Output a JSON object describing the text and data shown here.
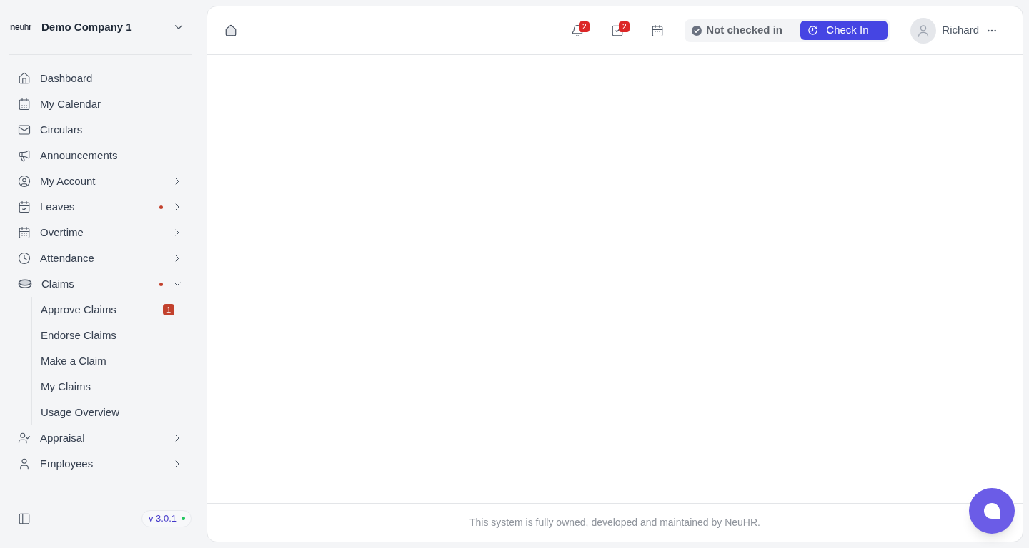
{
  "sidebar": {
    "logo": "**ne**uhr",
    "company": "Demo Company 1",
    "items": [
      {
        "label": "Dashboard",
        "kind": "link",
        "alert": false
      },
      {
        "label": "My Calendar",
        "kind": "link",
        "alert": false
      },
      {
        "label": "Circulars",
        "kind": "link",
        "alert": false
      },
      {
        "label": "Announcements",
        "kind": "link",
        "alert": false
      },
      {
        "label": "My Account",
        "kind": "group",
        "alert": false,
        "expanded": false
      },
      {
        "label": "Leaves",
        "kind": "group",
        "alert": true,
        "expanded": false
      },
      {
        "label": "Overtime",
        "kind": "group",
        "alert": false,
        "expanded": false
      },
      {
        "label": "Attendance",
        "kind": "group",
        "alert": false,
        "expanded": false
      },
      {
        "label": "Claims",
        "kind": "group",
        "alert": true,
        "expanded": true,
        "children": [
          {
            "label": "Approve Claims",
            "badge": "1"
          },
          {
            "label": "Endorse Claims"
          },
          {
            "label": "Make a Claim"
          },
          {
            "label": "My Claims"
          },
          {
            "label": "Usage Overview"
          }
        ]
      },
      {
        "label": "Appraisal",
        "kind": "group",
        "alert": false,
        "expanded": false
      },
      {
        "label": "Employees",
        "kind": "group",
        "alert": false,
        "expanded": false
      }
    ],
    "version": "v 3.0.1"
  },
  "header": {
    "notifications_badge": "2",
    "tasks_badge": "2",
    "attendance_status": "Not checked in",
    "check_in_button": "Check In",
    "user_name": "Richard"
  },
  "footer": "This system is fully owned, developed and maintained by NeuHR."
}
